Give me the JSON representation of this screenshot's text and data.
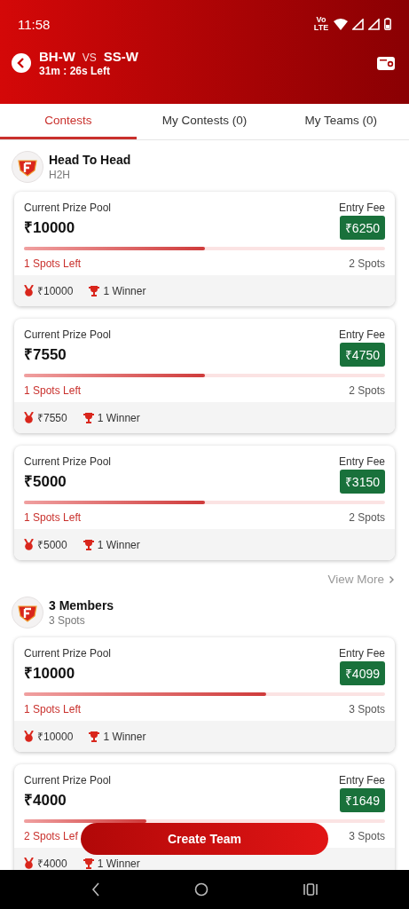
{
  "status_bar": {
    "time": "11:58",
    "network": "Vo LTE"
  },
  "header": {
    "team_1": "BH-W",
    "vs": "VS",
    "team_2": "SS-W",
    "time_left": "31m : 26s Left"
  },
  "tabs": [
    {
      "label": "Contests",
      "selected": true
    },
    {
      "label": "My Contests (0)",
      "selected": false
    },
    {
      "label": "My Teams (0)",
      "selected": false
    }
  ],
  "sections": [
    {
      "title": "Head To Head",
      "subtitle": "H2H",
      "view_more": "View More",
      "contests": [
        {
          "prize_label": "Current Prize Pool",
          "prize": "₹10000",
          "fee_label": "Entry Fee",
          "fee": "₹6250",
          "level": 0.5,
          "spots_left": "1 Spots Left",
          "spots": "2 Spots",
          "reward": "₹10000",
          "winners": "1 Winner"
        },
        {
          "prize_label": "Current Prize Pool",
          "prize": "₹7550",
          "fee_label": "Entry Fee",
          "fee": "₹4750",
          "level": 0.5,
          "spots_left": "1 Spots Left",
          "spots": "2 Spots",
          "reward": "₹7550",
          "winners": "1 Winner"
        },
        {
          "prize_label": "Current Prize Pool",
          "prize": "₹5000",
          "fee_label": "Entry Fee",
          "fee": "₹3150",
          "level": 0.5,
          "spots_left": "1 Spots Left",
          "spots": "2 Spots",
          "reward": "₹5000",
          "winners": "1 Winner"
        }
      ]
    },
    {
      "title": "3 Members",
      "subtitle": "3 Spots",
      "contests": [
        {
          "prize_label": "Current Prize Pool",
          "prize": "₹10000",
          "fee_label": "Entry Fee",
          "fee": "₹4099",
          "level": 0.67,
          "spots_left": "1 Spots Left",
          "spots": "3 Spots",
          "reward": "₹10000",
          "winners": "1 Winner"
        },
        {
          "prize_label": "Current Prize Pool",
          "prize": "₹4000",
          "fee_label": "Entry Fee",
          "fee": "₹1649",
          "level": 0.34,
          "spots_left": "2 Spots Lef",
          "spots": "3 Spots",
          "reward": "₹4000",
          "winners": "1 Winner"
        }
      ]
    }
  ],
  "create_button": "Create Team"
}
